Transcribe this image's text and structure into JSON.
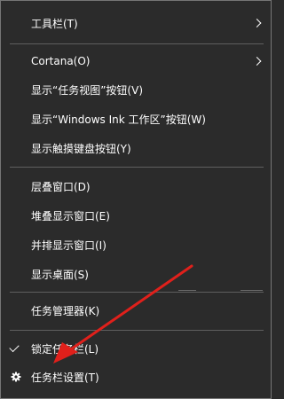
{
  "menu": {
    "items": [
      {
        "label": "工具栏(T)"
      },
      {
        "label": "Cortana(O)"
      },
      {
        "label": "显示“任务视图”按钮(V)"
      },
      {
        "label": "显示“Windows Ink 工作区”按钮(W)"
      },
      {
        "label": "显示触摸键盘按钮(Y)"
      },
      {
        "label": "层叠窗口(D)"
      },
      {
        "label": "堆叠显示窗口(E)"
      },
      {
        "label": "并排显示窗口(I)"
      },
      {
        "label": "显示桌面(S)"
      },
      {
        "label": "任务管理器(K)"
      },
      {
        "label": "锁定任务栏(L)"
      },
      {
        "label": "任务栏设置(T)"
      }
    ]
  },
  "colors": {
    "background": "#2b2b2b",
    "text": "#ffffff",
    "separator": "#5f5f5f",
    "annotation_arrow": "#e0201b"
  },
  "icons": {
    "submenu": "chevron-right-icon",
    "checked": "checkmark-icon",
    "settings": "gear-icon"
  }
}
